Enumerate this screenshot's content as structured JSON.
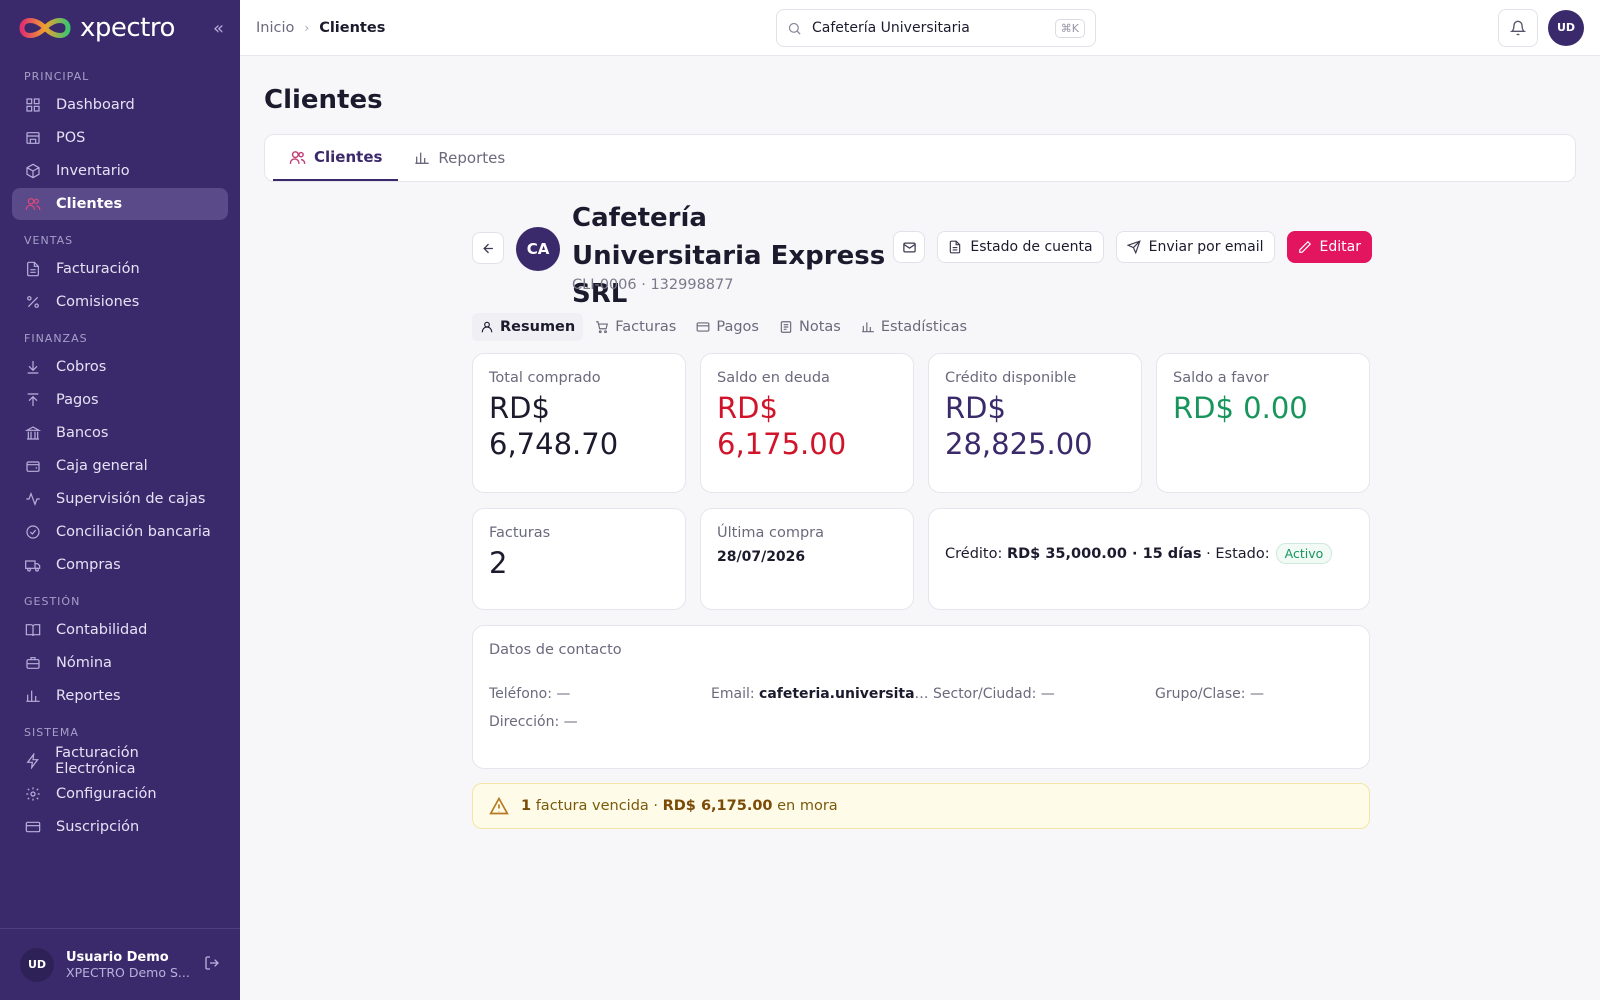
{
  "app": {
    "name": "xpectro"
  },
  "sidebar": {
    "sections": [
      {
        "title": "PRINCIPAL",
        "items": [
          {
            "label": "Dashboard",
            "icon": "grid-icon"
          },
          {
            "label": "POS",
            "icon": "store-icon"
          },
          {
            "label": "Inventario",
            "icon": "box-icon"
          },
          {
            "label": "Clientes",
            "icon": "users-icon",
            "active": true
          }
        ]
      },
      {
        "title": "VENTAS",
        "items": [
          {
            "label": "Facturación",
            "icon": "file-icon"
          },
          {
            "label": "Comisiones",
            "icon": "percent-icon"
          }
        ]
      },
      {
        "title": "FINANZAS",
        "items": [
          {
            "label": "Cobros",
            "icon": "arrow-down-icon"
          },
          {
            "label": "Pagos",
            "icon": "arrow-up-icon"
          },
          {
            "label": "Bancos",
            "icon": "bank-icon"
          },
          {
            "label": "Caja general",
            "icon": "wallet-icon"
          },
          {
            "label": "Supervisión de cajas",
            "icon": "activity-icon"
          },
          {
            "label": "Conciliación bancaria",
            "icon": "check-circle-icon"
          },
          {
            "label": "Compras",
            "icon": "truck-icon"
          }
        ]
      },
      {
        "title": "GESTIÓN",
        "items": [
          {
            "label": "Contabilidad",
            "icon": "book-icon"
          },
          {
            "label": "Nómina",
            "icon": "briefcase-icon"
          },
          {
            "label": "Reportes",
            "icon": "bar-chart-icon"
          }
        ]
      },
      {
        "title": "SISTEMA",
        "items": [
          {
            "label": "Facturación Electrónica",
            "icon": "zap-icon"
          },
          {
            "label": "Configuración",
            "icon": "gear-icon"
          },
          {
            "label": "Suscripción",
            "icon": "card-icon"
          }
        ]
      }
    ],
    "user": {
      "initials": "UD",
      "name": "Usuario Demo",
      "org": "XPECTRO Demo S..."
    }
  },
  "topbar": {
    "breadcrumb": {
      "home": "Inicio",
      "current": "Clientes"
    },
    "search_value": "Cafetería Universitaria",
    "search_shortcut": "⌘K",
    "avatar_initials": "UD"
  },
  "page": {
    "title": "Clientes",
    "tabs": [
      {
        "label": "Clientes",
        "active": true
      },
      {
        "label": "Reportes"
      }
    ]
  },
  "client": {
    "initials": "CA",
    "name": "Cafetería Universitaria Express SRL",
    "code": "CLI-0006 · 132998877",
    "actions": {
      "statement": "Estado de cuenta",
      "send_email": "Enviar por email",
      "edit": "Editar"
    },
    "subtabs": [
      "Resumen",
      "Facturas",
      "Pagos",
      "Notas",
      "Estadísticas"
    ],
    "stats": {
      "total_label": "Total comprado",
      "total_value": "RD$ 6,748.70",
      "debt_label": "Saldo en deuda",
      "debt_value": "RD$ 6,175.00",
      "credit_label": "Crédito disponible",
      "credit_value": "RD$ 28,825.00",
      "favor_label": "Saldo a favor",
      "favor_value": "RD$ 0.00",
      "invoices_label": "Facturas",
      "invoices_value": "2",
      "last_label": "Última compra",
      "last_value": "28/07/2026"
    },
    "credit_info": {
      "prefix": "Crédito:",
      "amount": "RD$ 35,000.00 · 15 días",
      "state_label": "· Estado:",
      "state": "Activo"
    },
    "contact": {
      "title": "Datos de contacto",
      "phone_label": "Teléfono:",
      "phone": "—",
      "email_label": "Email:",
      "email": "cafeteria.universitaria...",
      "sector_label": "Sector/Ciudad:",
      "sector": "—",
      "group_label": "Grupo/Clase:",
      "group": "—",
      "address_label": "Dirección:",
      "address": "—"
    },
    "alert": {
      "count_text": "1",
      "text1": " factura vencida · ",
      "amount": "RD$ 6,175.00",
      "text2": " en mora"
    }
  },
  "colors": {
    "sidebar": "#3b2a6b",
    "accent": "#e3155f",
    "danger": "#d0142a",
    "success": "#17955c"
  }
}
